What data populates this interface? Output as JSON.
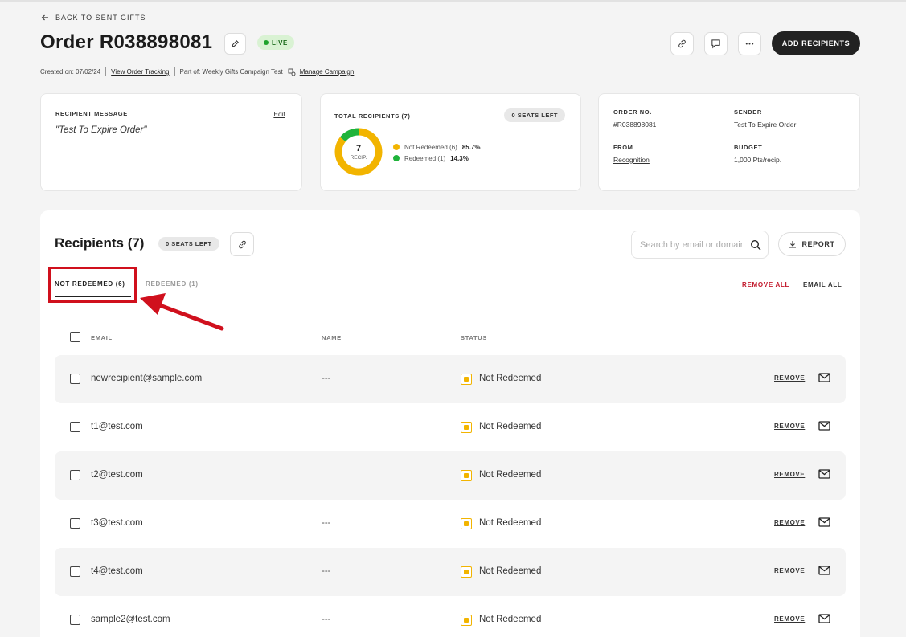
{
  "nav": {
    "back_label": "BACK TO SENT GIFTS"
  },
  "header": {
    "title": "Order R038898081",
    "status_badge": "LIVE",
    "add_recipients_label": "ADD RECIPIENTS"
  },
  "meta": {
    "created": "Created on: 07/02/24",
    "view_tracking": "View Order Tracking",
    "part_of": "Part of: Weekly Gifts Campaign Test",
    "manage_campaign": "Manage Campaign"
  },
  "message_card": {
    "label": "RECIPIENT MESSAGE",
    "edit_label": "Edit",
    "message": "\"Test To Expire Order\""
  },
  "recipients_card": {
    "label": "TOTAL RECIPIENTS (7)",
    "seats_badge": "0 SEATS LEFT",
    "donut_count": "7",
    "donut_unit": "RECIP.",
    "legend": [
      {
        "label": "Not Redeemed (6)",
        "pct": "85.7%",
        "color": "#f2b400",
        "value": 6
      },
      {
        "label": "Redeemed (1)",
        "pct": "14.3%",
        "color": "#1fb33a",
        "value": 1
      }
    ]
  },
  "order_card": {
    "order_no_label": "ORDER NO.",
    "order_no": "#R038898081",
    "sender_label": "SENDER",
    "sender": "Test To Expire Order",
    "from_label": "FROM",
    "from": "Recognition",
    "budget_label": "BUDGET",
    "budget": "1,000 Pts/recip."
  },
  "recipients": {
    "title": "Recipients (7)",
    "seats_badge": "0 SEATS LEFT",
    "search_placeholder": "Search by email or domain",
    "report_label": "REPORT",
    "tabs": [
      {
        "label": "NOT REDEEMED (6)",
        "active": true
      },
      {
        "label": "REDEEMED (1)",
        "active": false
      }
    ],
    "remove_all": "REMOVE ALL",
    "email_all": "EMAIL ALL",
    "columns": {
      "email": "EMAIL",
      "name": "NAME",
      "status": "STATUS"
    },
    "remove_label": "REMOVE",
    "rows": [
      {
        "email": "newrecipient@sample.com",
        "name": "---",
        "status": "Not Redeemed"
      },
      {
        "email": "t1@test.com",
        "name": "",
        "status": "Not Redeemed"
      },
      {
        "email": "t2@test.com",
        "name": "",
        "status": "Not Redeemed"
      },
      {
        "email": "t3@test.com",
        "name": "---",
        "status": "Not Redeemed"
      },
      {
        "email": "t4@test.com",
        "name": "---",
        "status": "Not Redeemed"
      },
      {
        "email": "sample2@test.com",
        "name": "---",
        "status": "Not Redeemed"
      }
    ]
  },
  "colors": {
    "accent_dark": "#222222",
    "live_green": "#1fa32b",
    "not_redeemed": "#f2b400",
    "redeemed": "#1fb33a",
    "highlight_red": "#d0101d"
  }
}
